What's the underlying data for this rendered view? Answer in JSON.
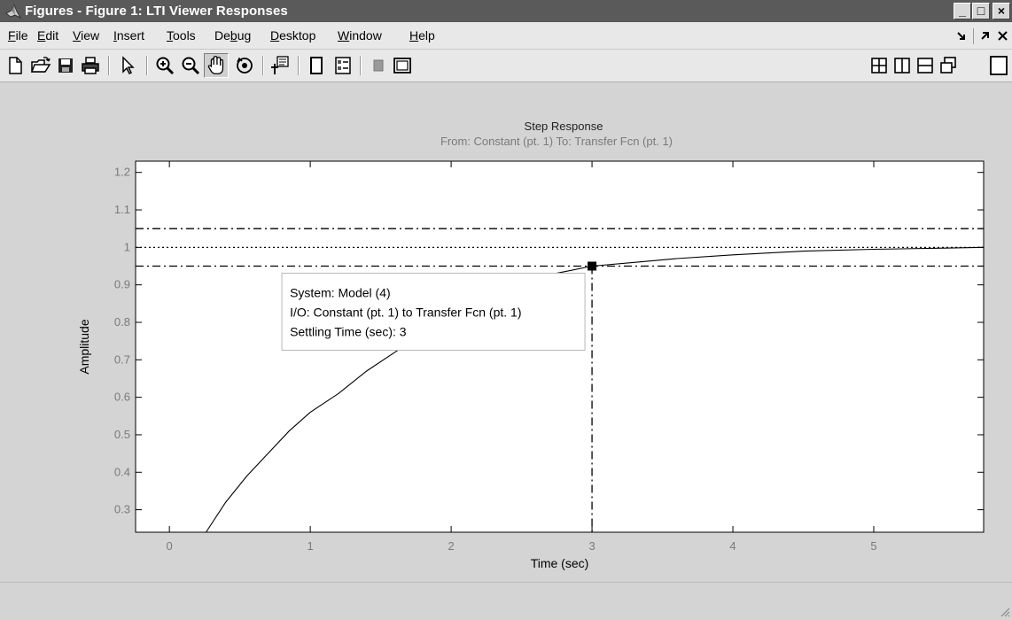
{
  "window": {
    "title": "Figures - Figure 1: LTI Viewer Responses",
    "controls": {
      "minimize": "_",
      "maximize": "□",
      "close": "×"
    }
  },
  "menubar": {
    "items": [
      {
        "label": "File",
        "mnemonic": "F"
      },
      {
        "label": "Edit",
        "mnemonic": "E"
      },
      {
        "label": "View",
        "mnemonic": "V"
      },
      {
        "label": "Insert",
        "mnemonic": "I"
      },
      {
        "label": "Tools",
        "mnemonic": "T"
      },
      {
        "label": "Debug",
        "mnemonic": "b"
      },
      {
        "label": "Desktop",
        "mnemonic": "D"
      },
      {
        "label": "Window",
        "mnemonic": "W"
      },
      {
        "label": "Help",
        "mnemonic": "H"
      }
    ],
    "right_icons": [
      "dock-icon",
      "undock-icon",
      "close-figure-icon"
    ]
  },
  "toolbar": {
    "left": [
      "new-figure-icon",
      "open-file-icon",
      "save-icon",
      "print-icon",
      "edit-plot-icon",
      "zoom-in-icon",
      "zoom-out-icon",
      "pan-icon",
      "rotate-3d-icon",
      "data-cursor-icon",
      "hide-plot-tools-icon",
      "insert-legend-icon",
      "insert-colorbar-icon",
      "show-plot-tools-icon"
    ],
    "pressed": "pan-icon",
    "right": [
      "tile-grid-icon",
      "tile-left-right-icon",
      "tile-top-bottom-icon",
      "float-icon",
      "maximize-figure-icon"
    ]
  },
  "chart_data": {
    "type": "line",
    "title": "Step Response",
    "subtitle": "From: Constant (pt. 1)  To: Transfer Fcn (pt. 1)",
    "xlabel": "Time (sec)",
    "ylabel": "Amplitude",
    "xlim": [
      -0.24,
      5.78
    ],
    "ylim": [
      0.24,
      1.23
    ],
    "xticks": [
      0,
      1,
      2,
      3,
      4,
      5
    ],
    "yticks": [
      0.3,
      0.4,
      0.5,
      0.6,
      0.7,
      0.8,
      0.9,
      1,
      1.1,
      1.2
    ],
    "ytick_labels": [
      "0.3",
      "0.4",
      "0.5",
      "0.6",
      "0.7",
      "0.8",
      "0.9",
      "1",
      "1.1",
      "1.2"
    ],
    "grid": false,
    "series": [
      {
        "x": [
          0.26,
          0.4,
          0.55,
          0.7,
          0.85,
          1.0,
          1.2,
          1.4,
          1.6,
          1.8,
          2.0,
          2.2,
          2.4,
          2.6,
          2.8,
          3.0,
          3.3,
          3.6,
          4.0,
          4.5,
          5.0,
          5.5,
          5.78
        ],
        "y": [
          0.24,
          0.32,
          0.39,
          0.45,
          0.51,
          0.56,
          0.61,
          0.67,
          0.72,
          0.77,
          0.82,
          0.86,
          0.89,
          0.92,
          0.935,
          0.95,
          0.96,
          0.97,
          0.98,
          0.99,
          0.995,
          0.998,
          1.0
        ],
        "color": "#000000"
      }
    ],
    "reference_lines": [
      {
        "y": 1.0,
        "style": "dotted"
      },
      {
        "y": 1.05,
        "style": "dashdot"
      },
      {
        "y": 0.95,
        "style": "dashdot"
      }
    ],
    "settling_time_marker": {
      "x": 3,
      "y": 0.95
    },
    "datatip": {
      "lines": [
        "System: Model (4)",
        "I/O: Constant (pt. 1) to Transfer Fcn (pt. 1)",
        "Settling Time (sec): 3"
      ]
    }
  }
}
